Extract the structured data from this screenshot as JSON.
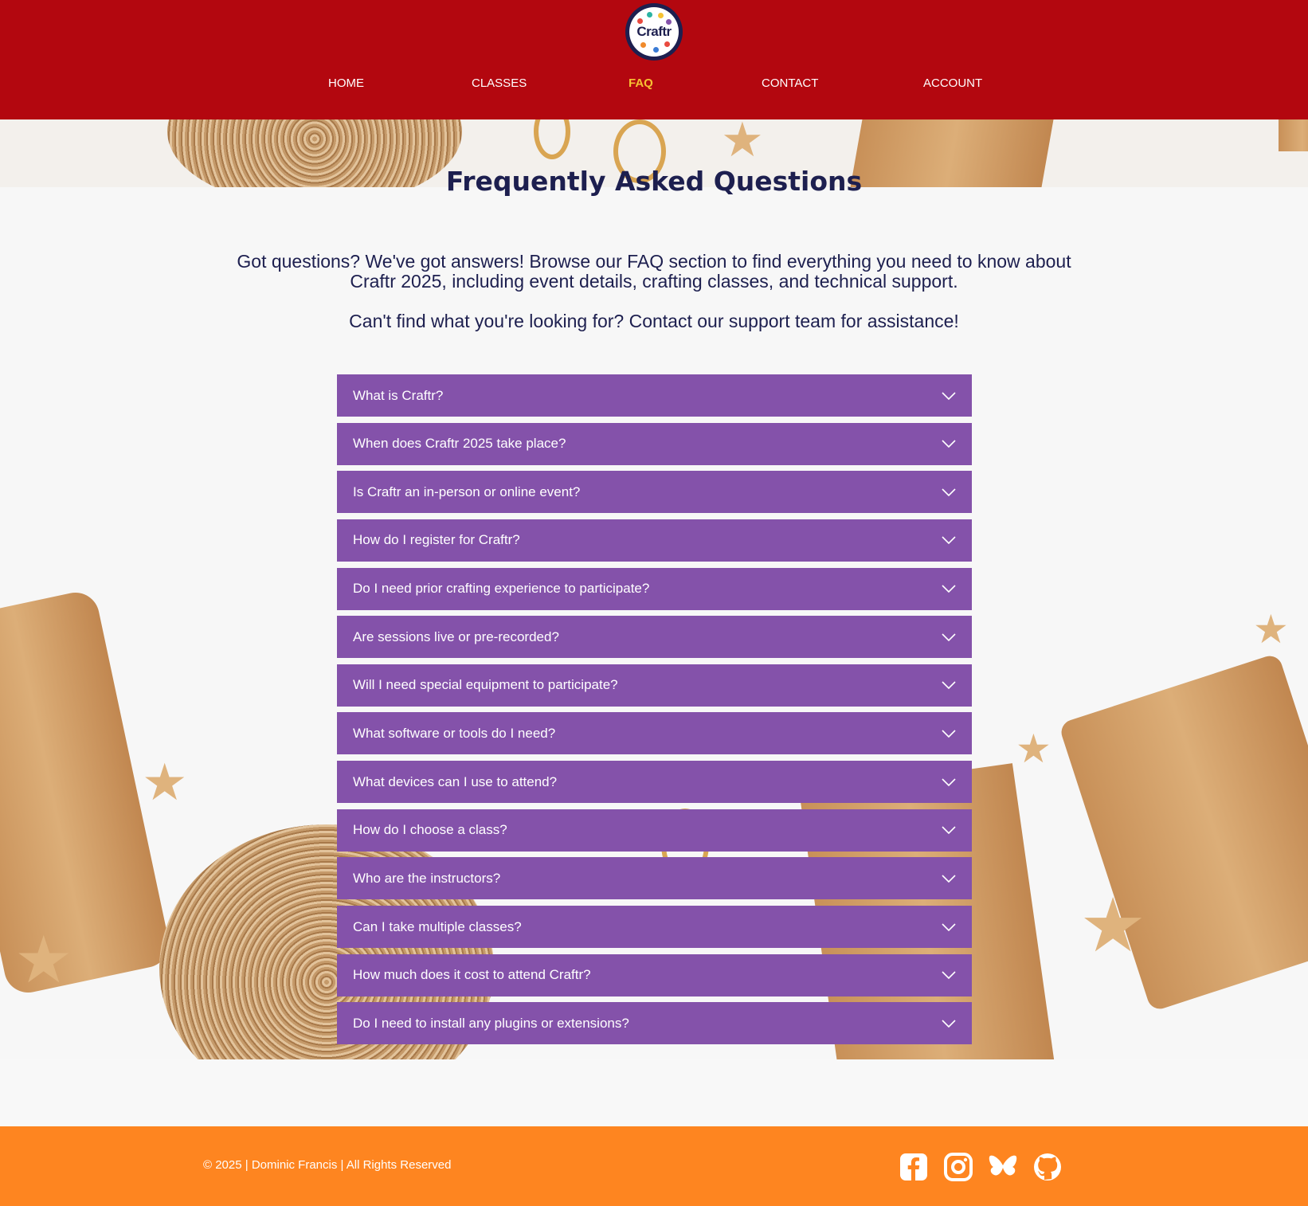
{
  "brand": {
    "logo_text": "Craftr"
  },
  "nav": {
    "items": [
      {
        "label": "HOME"
      },
      {
        "label": "CLASSES"
      },
      {
        "label": "FAQ"
      },
      {
        "label": "CONTACT"
      },
      {
        "label": "ACCOUNT"
      }
    ],
    "active": "FAQ"
  },
  "page": {
    "title": "Frequently Asked Questions",
    "intro": "Got questions? We've got answers! Browse our FAQ section to find everything you need to know about Craftr 2025, including event details, crafting classes, and technical support.",
    "intro_secondary": "Can't find what you're looking for? Contact our support team for assistance!"
  },
  "faq": [
    {
      "question": "What is Craftr?"
    },
    {
      "question": "When does Craftr 2025 take place?"
    },
    {
      "question": "Is Craftr an in-person or online event?"
    },
    {
      "question": "How do I register for Craftr?"
    },
    {
      "question": "Do I need prior crafting experience to participate?"
    },
    {
      "question": "Are sessions live or pre-recorded?"
    },
    {
      "question": "Will I need special equipment to participate?"
    },
    {
      "question": "What software or tools do I need?"
    },
    {
      "question": "What devices can I use to attend?"
    },
    {
      "question": "How do I choose a class?"
    },
    {
      "question": "Who are the instructors?"
    },
    {
      "question": "Can I take multiple classes?"
    },
    {
      "question": "How much does it cost to attend Craftr?"
    },
    {
      "question": "Do I need to install any plugins or extensions?"
    }
  ],
  "footer": {
    "copyright": "© 2025 | Dominic Francis | All Rights Reserved",
    "social": [
      "facebook-icon",
      "instagram-icon",
      "bluesky-icon",
      "github-icon"
    ]
  },
  "colors": {
    "header": "#b3070f",
    "nav_active": "#f6c233",
    "accordion": "#8452aa",
    "footer": "#fe8520",
    "title": "#1d1f4f"
  }
}
